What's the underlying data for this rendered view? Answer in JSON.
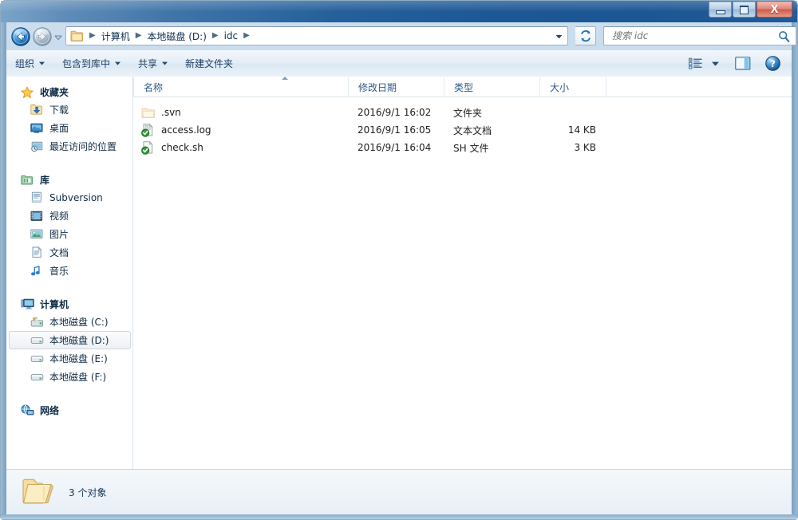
{
  "window": {
    "title": "",
    "controls": {
      "minimize": "minimize",
      "maximize": "maximize",
      "close": "X"
    }
  },
  "address_bar": {
    "back_tooltip": "后退",
    "forward_tooltip": "前进",
    "breadcrumbs": [
      "计算机",
      "本地磁盘 (D:)",
      "idc"
    ],
    "separator": "►",
    "refresh_label": "刷新"
  },
  "search": {
    "placeholder": "搜索 idc",
    "value": ""
  },
  "toolbar": {
    "items": [
      {
        "label": "组织",
        "has_caret": true
      },
      {
        "label": "包含到库中",
        "has_caret": true
      },
      {
        "label": "共享",
        "has_caret": true
      },
      {
        "label": "新建文件夹",
        "has_caret": false
      }
    ],
    "views_label": "更改您的视图",
    "preview_label": "显示预览窗格",
    "help_label": "获取帮助"
  },
  "sidebar": {
    "groups": [
      {
        "header": {
          "label": "收藏夹",
          "icon": "star-icon"
        },
        "items": [
          {
            "label": "下载",
            "icon": "downloads-icon",
            "selected": false
          },
          {
            "label": "桌面",
            "icon": "desktop-icon",
            "selected": false
          },
          {
            "label": "最近访问的位置",
            "icon": "recent-places-icon",
            "selected": false
          }
        ]
      },
      {
        "header": {
          "label": "库",
          "icon": "library-icon"
        },
        "items": [
          {
            "label": "Subversion",
            "icon": "subversion-library-icon",
            "selected": false
          },
          {
            "label": "视频",
            "icon": "videos-icon",
            "selected": false
          },
          {
            "label": "图片",
            "icon": "pictures-icon",
            "selected": false
          },
          {
            "label": "文档",
            "icon": "documents-icon",
            "selected": false
          },
          {
            "label": "音乐",
            "icon": "music-icon",
            "selected": false
          }
        ]
      },
      {
        "header": {
          "label": "计算机",
          "icon": "computer-icon"
        },
        "items": [
          {
            "label": "本地磁盘 (C:)",
            "icon": "system-drive-icon",
            "selected": false
          },
          {
            "label": "本地磁盘 (D:)",
            "icon": "drive-icon",
            "selected": true
          },
          {
            "label": "本地磁盘 (E:)",
            "icon": "drive-icon",
            "selected": false
          },
          {
            "label": "本地磁盘 (F:)",
            "icon": "drive-icon",
            "selected": false
          }
        ]
      },
      {
        "header": {
          "label": "网络",
          "icon": "network-icon"
        },
        "items": []
      }
    ]
  },
  "file_list": {
    "columns": [
      {
        "label": "名称",
        "sorted": true,
        "sort_direction": "asc"
      },
      {
        "label": "修改日期",
        "sorted": false
      },
      {
        "label": "类型",
        "sorted": false
      },
      {
        "label": "大小",
        "sorted": false
      }
    ],
    "rows": [
      {
        "name": ".svn",
        "date": "2016/9/1 16:02",
        "type": "文件夹",
        "size": "",
        "icon": "folder-hidden-icon",
        "overlay": ""
      },
      {
        "name": "access.log",
        "date": "2016/9/1 16:05",
        "type": "文本文档",
        "size": "14 KB",
        "icon": "text-file-icon",
        "overlay": "svn-normal-check-overlay"
      },
      {
        "name": "check.sh",
        "date": "2016/9/1 16:04",
        "type": "SH 文件",
        "size": "3 KB",
        "icon": "generic-file-icon",
        "overlay": "svn-normal-check-overlay"
      }
    ]
  },
  "status_bar": {
    "icon": "open-folder-icon",
    "text": "3 个对象"
  },
  "colors": {
    "titlebar_dark": "#1c5895",
    "titlebar_light": "#7ba4c9",
    "close_button": "#cf5948",
    "accent_blue": "#2c5a87",
    "folder_yellow": "#f5d98b",
    "svn_green": "#2a9a2a",
    "selection_border": "#cfd8e0"
  }
}
